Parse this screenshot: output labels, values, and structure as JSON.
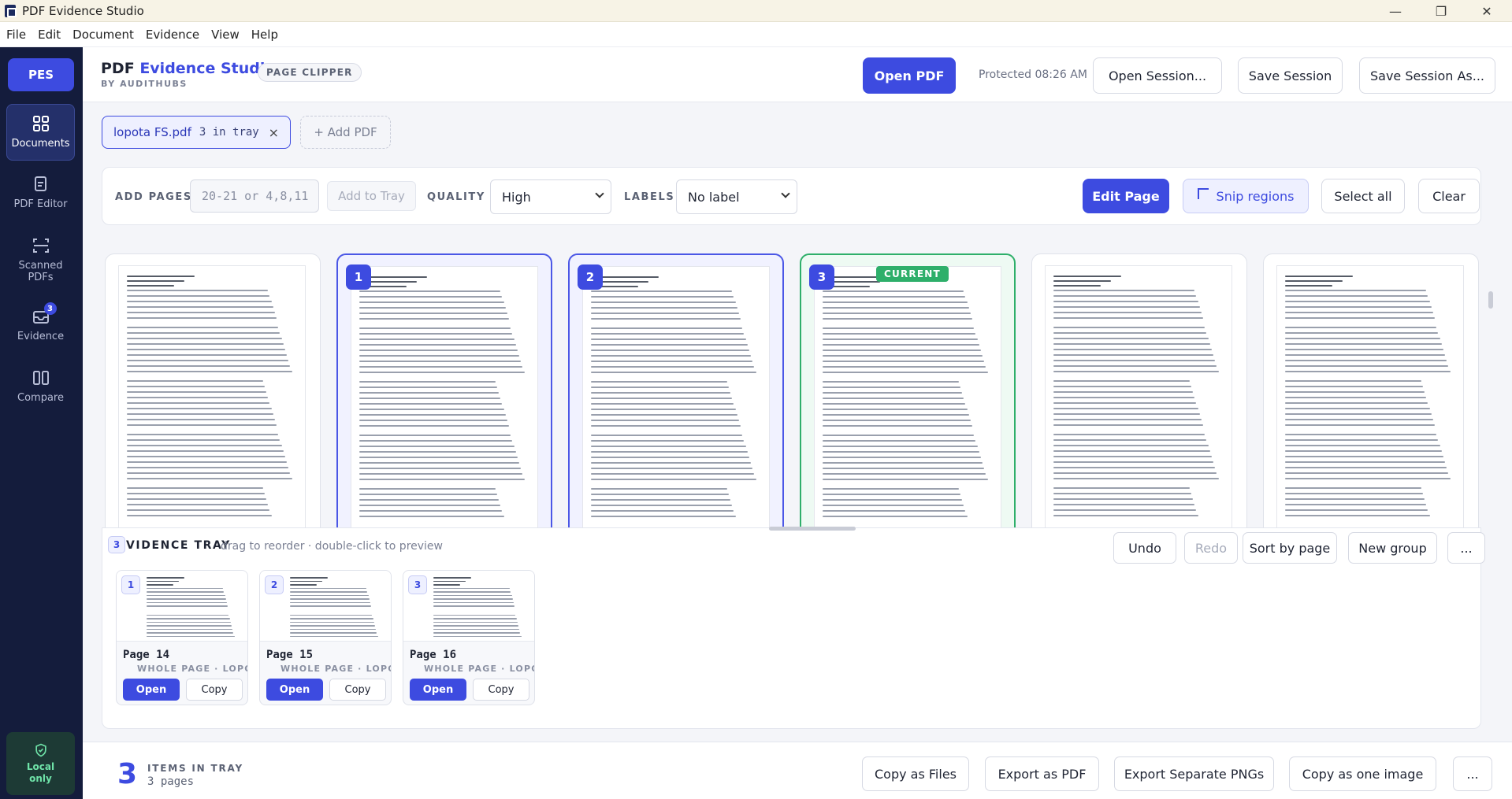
{
  "window": {
    "title": "PDF Evidence Studio",
    "minimize": "—",
    "maximize": "❐",
    "close": "✕"
  },
  "menu": [
    "File",
    "Edit",
    "Document",
    "Evidence",
    "View",
    "Help"
  ],
  "sidebar": {
    "logo": "PES",
    "items": [
      {
        "label": "Documents",
        "icon": "grid-icon"
      },
      {
        "label": "PDF Editor",
        "icon": "edit-doc-icon"
      },
      {
        "label": "Scanned PDFs",
        "icon": "scan-icon"
      },
      {
        "label": "Evidence",
        "icon": "tray-icon",
        "badge": "3"
      },
      {
        "label": "Compare",
        "icon": "columns-icon"
      }
    ],
    "local": {
      "line1": "Local",
      "line2": "only",
      "icon": "shield-check-icon"
    }
  },
  "header": {
    "brand_plain": "PDF",
    "brand_accent": "Evidence Studio",
    "byline": "BY AUDITHUBS",
    "mode": "PAGE CLIPPER",
    "open_pdf": "Open PDF",
    "protected": "Protected 08:26 AM",
    "open_session": "Open Session...",
    "save_session": "Save Session",
    "save_session_as": "Save Session As..."
  },
  "documents": {
    "active": {
      "name": "lopota FS.pdf",
      "count": "3 in tray",
      "close": "×"
    },
    "add": "+ Add PDF"
  },
  "toolbar": {
    "add_pages_label": "ADD PAGES",
    "pages_placeholder": "20-21 or 4,8,11",
    "add_to_tray": "Add to Tray",
    "quality_label": "QUALITY",
    "quality_value": "High",
    "labels_label": "LABELS",
    "labels_value": "No label",
    "edit_page": "Edit Page",
    "snip_regions": "Snip regions",
    "select_all": "Select all",
    "clear": "Clear"
  },
  "pages": [
    {
      "state": "plain",
      "badge": ""
    },
    {
      "state": "selected",
      "badge": "1"
    },
    {
      "state": "selected",
      "badge": "2"
    },
    {
      "state": "current",
      "badge": "3",
      "current_label": "CURRENT"
    },
    {
      "state": "plain",
      "badge": ""
    },
    {
      "state": "plain",
      "badge": ""
    }
  ],
  "tray": {
    "count": "3",
    "title": "VIDENCE TRAY",
    "hint": "drag to reorder · double-click to preview",
    "undo": "Undo",
    "redo": "Redo",
    "sort_by_page": "Sort by page",
    "new_group": "New group",
    "more": "...",
    "items": [
      {
        "num": "1",
        "page": "Page 14",
        "sub": "WHOLE PAGE · LOPOTA FS.PDF",
        "open": "Open",
        "copy": "Copy"
      },
      {
        "num": "2",
        "page": "Page 15",
        "sub": "WHOLE PAGE · LOPOTA FS.PDF",
        "open": "Open",
        "copy": "Copy"
      },
      {
        "num": "3",
        "page": "Page 16",
        "sub": "WHOLE PAGE · LOPOTA FS.PDF",
        "open": "Open",
        "copy": "Copy"
      }
    ]
  },
  "footer": {
    "count": "3",
    "label": "ITEMS IN TRAY",
    "sub": "3 pages",
    "copy_as_files": "Copy as Files",
    "export_pdf": "Export as PDF",
    "export_pngs": "Export Separate PNGs",
    "copy_one_image": "Copy as one image",
    "more": "..."
  },
  "colors": {
    "accent": "#3d4be0",
    "sidebar": "#141c3c",
    "current": "#2eaf6a"
  }
}
